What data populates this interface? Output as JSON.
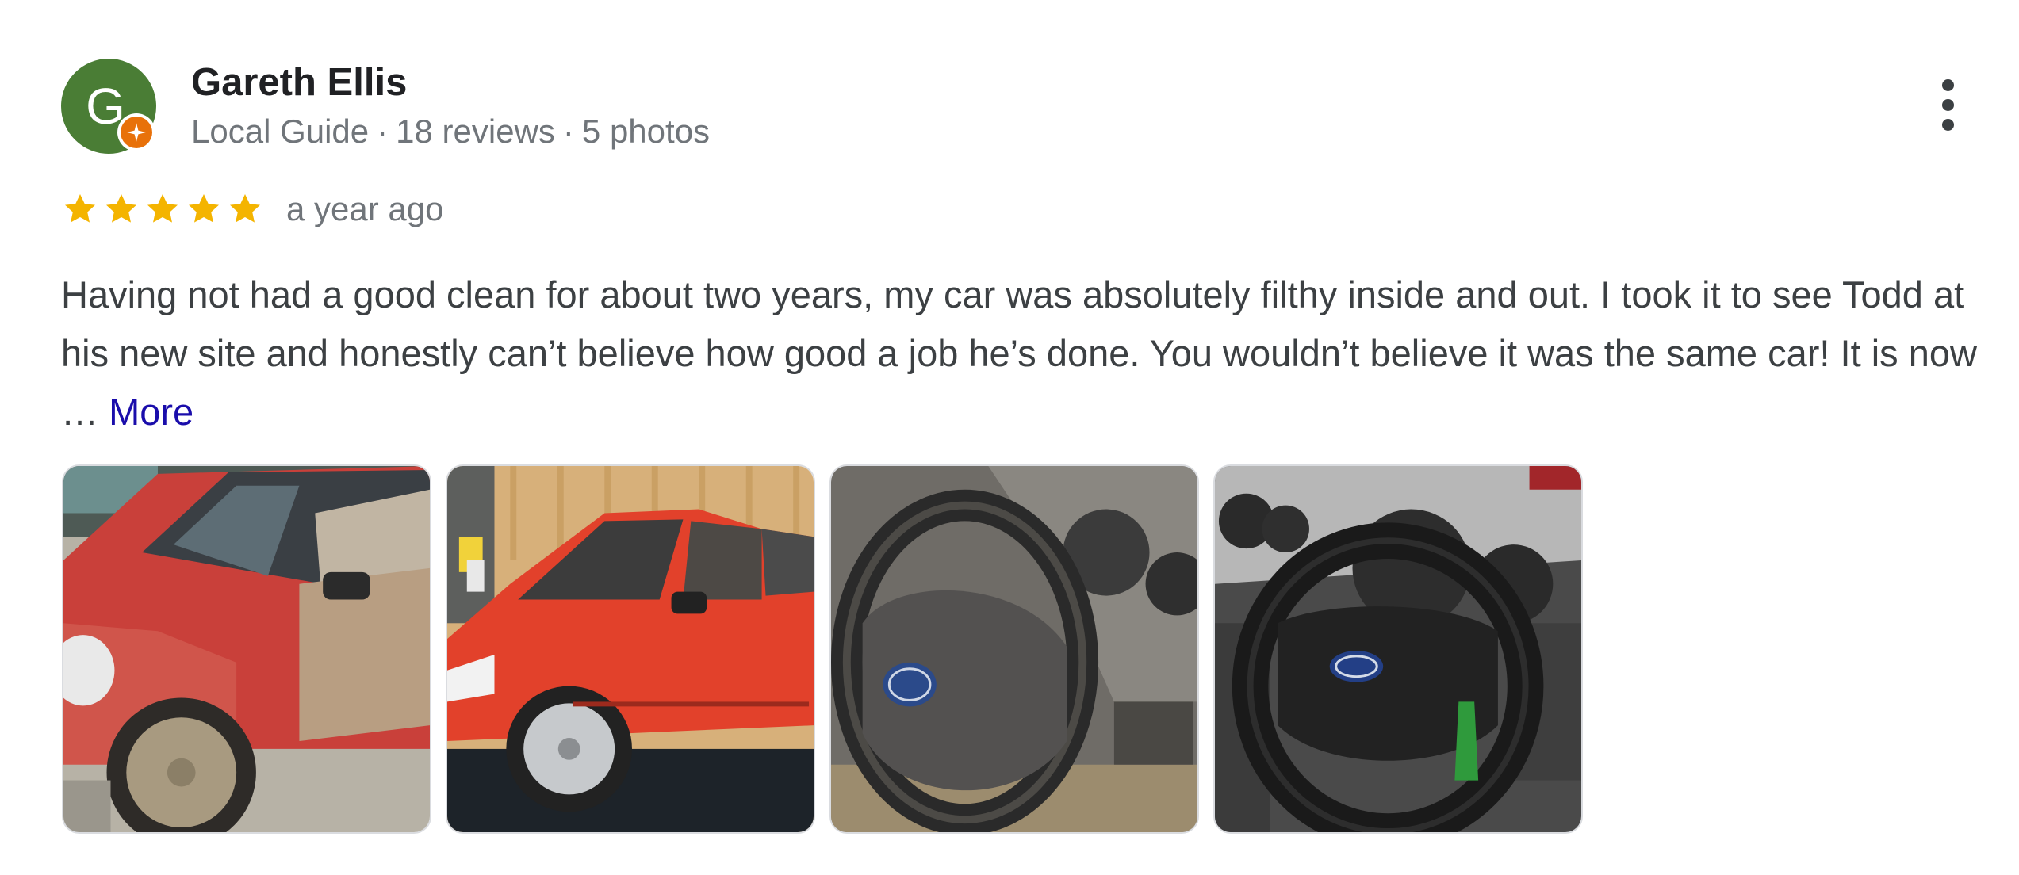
{
  "reviewer": {
    "avatar_letter": "G",
    "avatar_color": "#4a7d35",
    "badge_color": "#e8710a",
    "badge_icon": "local-guide-star-icon",
    "name": "Gareth Ellis",
    "meta": {
      "guide": "Local Guide",
      "separator": "·",
      "reviews": "18 reviews",
      "photos": "5 photos"
    }
  },
  "menu": {
    "icon": "more-vertical-icon"
  },
  "rating": {
    "stars": 5,
    "max": 5,
    "star_color": "#f4b400",
    "date": "a year ago"
  },
  "review": {
    "text": "Having not had a good clean for about two years, my car was absolutely filthy inside and out. I took it to see Todd at his new site and honestly can’t believe how good a job he’s done. You wouldn’t believe it was the same car! It is now …",
    "more_label": "More",
    "more_color": "#1a0dab"
  },
  "photos": [
    {
      "subject": "red car exterior before cleaning"
    },
    {
      "subject": "red car exterior after cleaning"
    },
    {
      "subject": "steering wheel before cleaning"
    },
    {
      "subject": "steering wheel after cleaning"
    }
  ]
}
